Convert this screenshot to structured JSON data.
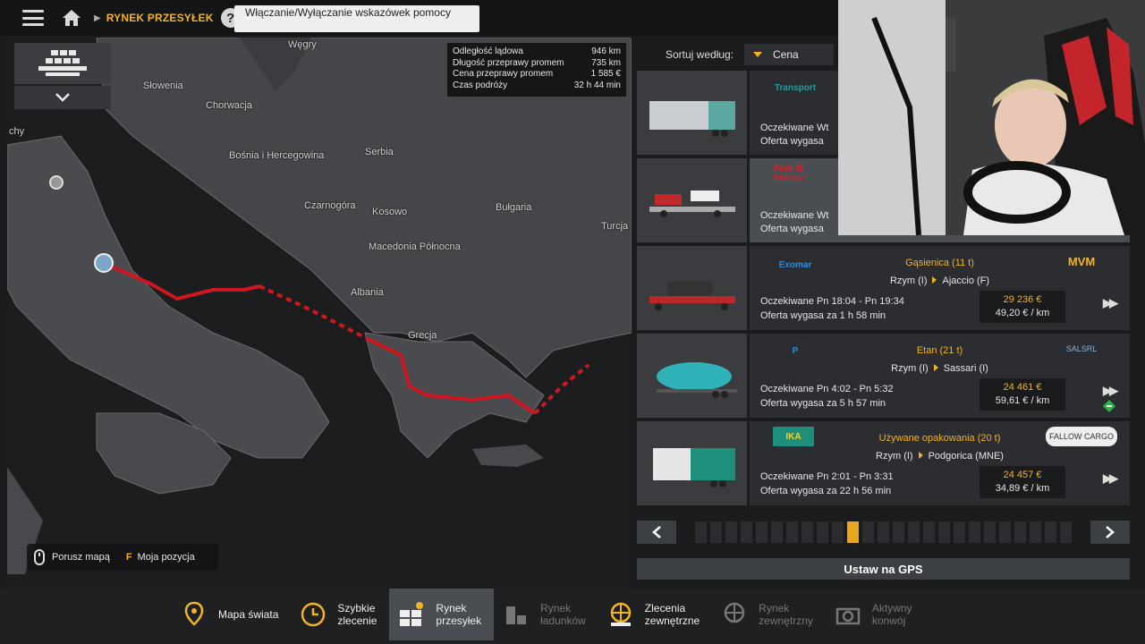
{
  "topbar": {
    "breadcrumb": "RYNEK PRZESYŁEK",
    "help": "?",
    "tooltip": "Włączanie/Wyłączanie wskazówek pomocy"
  },
  "map": {
    "labels": [
      "Węgry",
      "Słowenia",
      "Chorwacja",
      "Bośnia i Hercegowina",
      "Serbia",
      "Czarnogóra",
      "Kosowo",
      "Bułgaria",
      "Macedonia Północna",
      "Turcja",
      "Albania",
      "Grecja",
      "chy"
    ],
    "info": [
      {
        "label": "Odległość lądowa",
        "value": "946 km"
      },
      {
        "label": "Długość przeprawy promem",
        "value": "735 km"
      },
      {
        "label": "Cena przeprawy promem",
        "value": "1 585 €"
      },
      {
        "label": "Czas podróży",
        "value": "32 h 44 min"
      }
    ],
    "hint_move": "Porusz mapą",
    "hint_key": "F",
    "hint_position": "Moja pozycja"
  },
  "sort": {
    "label": "Sortuj według:",
    "value": "Cena"
  },
  "offers": [
    {
      "expected": "Oczekiwane Wt",
      "expires": "Oferta wygasa",
      "logo": "Transport"
    },
    {
      "expected": "Oczekiwane Wt",
      "expires": "Oferta wygasa",
      "logo": "Auto di Alonso"
    },
    {
      "logo": "Exomar",
      "cargo": "Gąsienica (11 t)",
      "from": "Rzym (I)",
      "to": "Ajaccio (F)",
      "expected": "Oczekiwane Pn 18:04 - Pn 19:34",
      "expires": "Oferta wygasa za 1 h 58 min",
      "price": "29 236 €",
      "per_km": "49,20 € / km",
      "company": "MVM"
    },
    {
      "logo": "P",
      "cargo": "Etan (21 t)",
      "from": "Rzym (I)",
      "to": "Sassari (I)",
      "expected": "Oczekiwane Pn 4:02 - Pn 5:32",
      "expires": "Oferta wygasa za 5 h 57 min",
      "price": "24 461 €",
      "per_km": "59,61 € / km",
      "company": "SALSRL"
    },
    {
      "logo": "IKA",
      "cargo": "Używane opakowania (20 t)",
      "from": "Rzym (I)",
      "to": "Podgorica (MNE)",
      "expected": "Oczekiwane Pn 2:01 - Pn 3:31",
      "expires": "Oferta wygasa za 22 h 56 min",
      "price": "24 457 €",
      "per_km": "34,89 € / km",
      "company": "FALLOW CARGO"
    }
  ],
  "gps_button": "Ustaw na GPS",
  "bottom_tabs": [
    {
      "label1": "Mapa świata",
      "label2": ""
    },
    {
      "label1": "Szybkie",
      "label2": "zlecenie"
    },
    {
      "label1": "Rynek",
      "label2": "przesyłek"
    },
    {
      "label1": "Rynek",
      "label2": "ładunków"
    },
    {
      "label1": "Zlecenia",
      "label2": "zewnętrzne"
    },
    {
      "label1": "Rynek",
      "label2": "zewnętrzny"
    },
    {
      "label1": "Aktywny",
      "label2": "konwój"
    }
  ],
  "colors": {
    "accent": "#f2b424",
    "route": "#d0161e",
    "panel": "#2b2d31"
  }
}
